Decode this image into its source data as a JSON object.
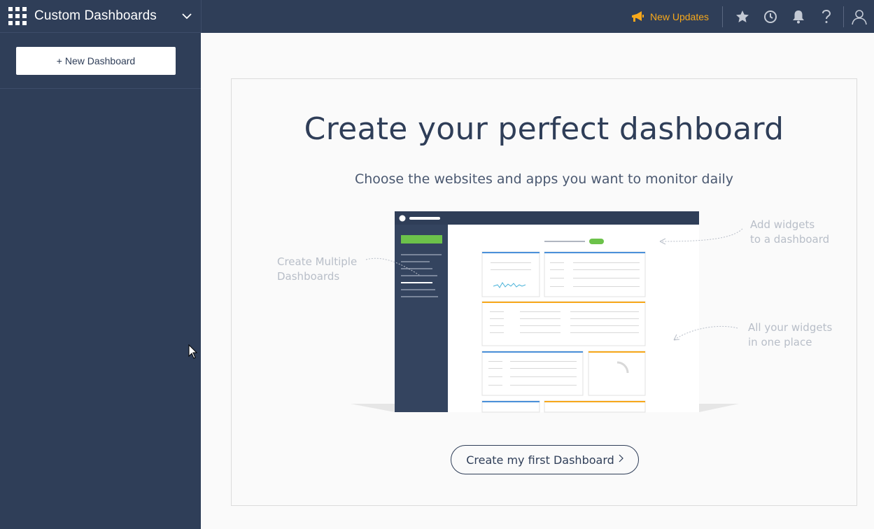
{
  "sidebar": {
    "title": "Custom Dashboards",
    "new_dashboard_label": "+ New Dashboard"
  },
  "topbar": {
    "updates_label": "New Updates",
    "icons": [
      "star-icon",
      "clock-icon",
      "bell-icon",
      "help-icon",
      "user-icon"
    ]
  },
  "main": {
    "headline": "Create your perfect dashboard",
    "subheadline": "Choose the websites and apps you want to monitor daily",
    "annotations": {
      "multiple": [
        "Create Multiple",
        "Dashboards"
      ],
      "add_widgets": [
        "Add widgets",
        "to a dashboard"
      ],
      "all_widgets": [
        "All your widgets",
        "in one place"
      ]
    },
    "cta_label": "Create my first Dashboard"
  },
  "colors": {
    "sidebar_bg": "#2f3e58",
    "accent_orange": "#f7a81b",
    "accent_green": "#6cc24a",
    "accent_blue": "#4a90d9"
  }
}
